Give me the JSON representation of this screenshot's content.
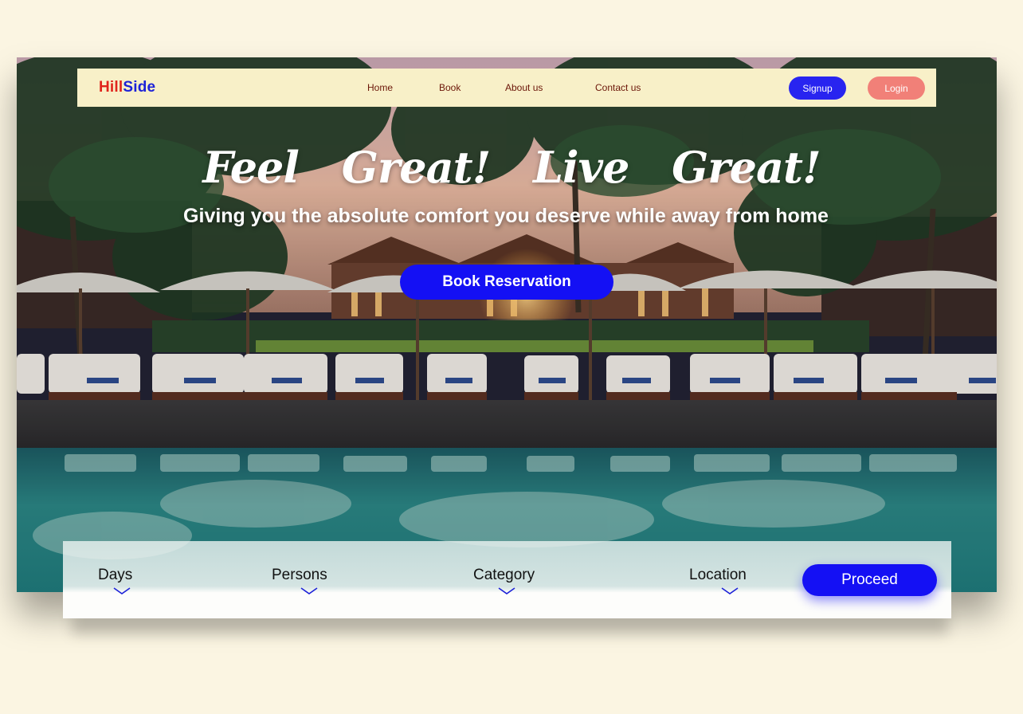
{
  "brand": {
    "part1": "Hill",
    "part2": "Side"
  },
  "nav": {
    "links": [
      "Home",
      "Book",
      "About us",
      "Contact us"
    ],
    "signup_label": "Signup",
    "login_label": "Login"
  },
  "hero": {
    "headline": "Feel Great!  Live Great!",
    "subheadline": "Giving you the absolute comfort you deserve while away from home",
    "cta_label": "Book Reservation"
  },
  "search": {
    "fields": [
      "Days",
      "Persons",
      "Category",
      "Location"
    ],
    "proceed_label": "Proceed"
  },
  "colors": {
    "background": "#fbf5e2",
    "navbar": "#f8f0c8",
    "brand_red": "#e0241c",
    "brand_blue": "#1d22d8",
    "primary_button": "#1410f4",
    "login_button": "#f18078",
    "nav_link": "#6b1608"
  },
  "icons": {
    "field_dropdown": "chevron-down-icon"
  }
}
